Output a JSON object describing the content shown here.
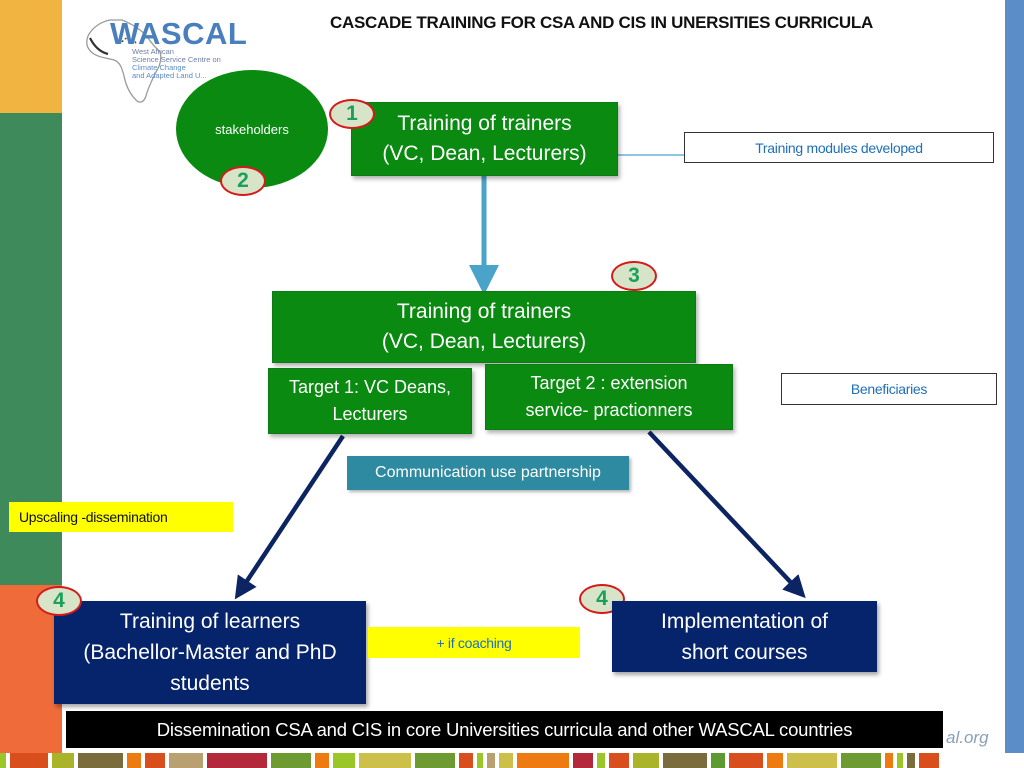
{
  "title": "CASCADE TRAINING FOR CSA AND CIS IN UNERSITIES CURRICULA",
  "logo": {
    "name": "WASCAL",
    "subtitle_lines": [
      "West African",
      "Science Service Centre on",
      "Climate Change",
      "and Adapted Land U..."
    ]
  },
  "nodes": {
    "stakeholders": "stakeholders",
    "trainers_top": {
      "line1": "Training of trainers",
      "line2": "(VC, Dean, Lecturers)"
    },
    "trainers_mid": {
      "line1": "Training of trainers",
      "line2": "(VC, Dean, Lecturers)"
    },
    "target1": {
      "line1": "Target 1: VC Deans,",
      "line2": "Lecturers"
    },
    "target2": {
      "line1": "Target 2 : extension",
      "line2": "service- practionners"
    },
    "modules": "Training modules developed",
    "beneficiaries": "Beneficiaries",
    "communication": "Communication use partnership",
    "upscaling": "Upscaling -dissemination",
    "coaching": "+  if coaching",
    "learners": {
      "line1": "Training of learners",
      "line2": "(Bachellor-Master and PhD",
      "line3": "students"
    },
    "courses": {
      "line1": "Implementation of",
      "line2": "short courses"
    },
    "dissemination": "Dissemination CSA  and CIS in core Universities curricula and other WASCAL countries"
  },
  "badges": {
    "step1": "1",
    "step2": "2",
    "step3": "3",
    "step4_left": "4",
    "step4_right": "4"
  },
  "footer_url_fragment": "al.org",
  "colors": {
    "green_box": "#0a8a10",
    "navy_box": "#06246b",
    "teal_box": "#2e8aa0",
    "highlight_yellow": "#ffff00",
    "badge_border": "#d51a1a",
    "badge_text": "#1aa05a",
    "link_blue": "#1e6fb8",
    "arrow_light_blue": "#4aa3c9",
    "arrow_navy": "#0c2462"
  },
  "bottom_strip_colors": [
    "#9bc62a",
    "#d84e1c",
    "#a9b42a",
    "#7a6c3c",
    "#ee7a12",
    "#d84e1c",
    "#b8a070",
    "#b3283a",
    "#6e9a32",
    "#ee7a12",
    "#9bc62a",
    "#ccc04a",
    "#6e9a32",
    "#d84e1c",
    "#9bc62a",
    "#b8a070",
    "#ccc04a",
    "#ee7a12",
    "#b3283a",
    "#9bc62a",
    "#d84e1c",
    "#a9b42a",
    "#7a6c3c",
    "#5e9a32",
    "#d84e1c",
    "#ee7a12",
    "#ccc04a",
    "#6e9a32",
    "#ee7a12",
    "#9bc62a",
    "#7a6c3c",
    "#d84e1c"
  ]
}
